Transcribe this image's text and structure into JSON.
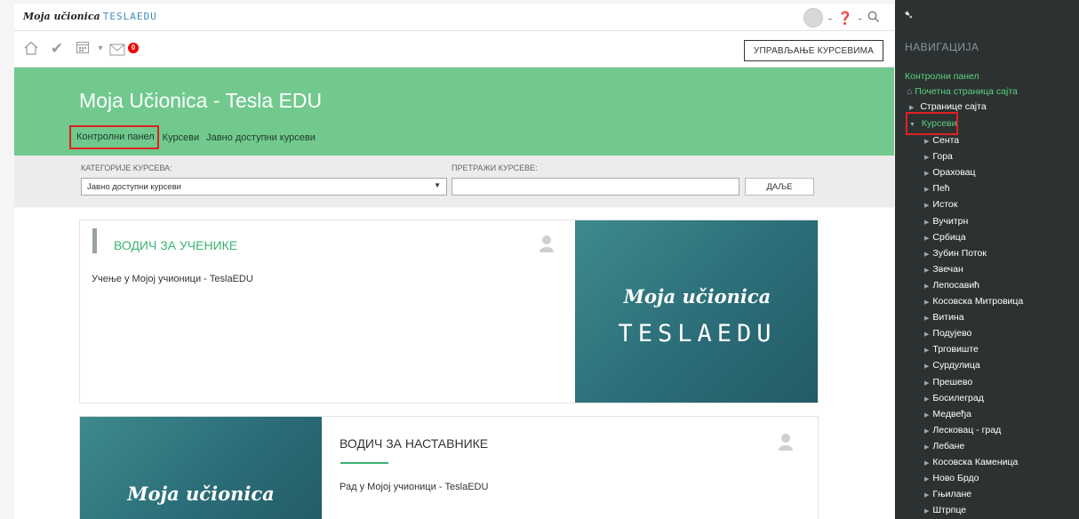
{
  "topbar": {
    "logo_script": "Moja učionica",
    "logo_brand": "TESLAEDU"
  },
  "toolbar": {
    "notification_count": "0",
    "manage_courses_label": "УПРАВЉАЊЕ КУРСЕВИМА"
  },
  "hero": {
    "title": "Moja Učionica - Tesla EDU",
    "breadcrumb": [
      "Контролни панел",
      "Курсеви",
      "Јавно доступни курсеви"
    ]
  },
  "filter": {
    "category_label": "КАТЕГОРИЈЕ КУРСЕВА:",
    "category_value": "Јавно доступни курсеви",
    "search_label": "ПРЕТРАЖИ КУРСЕВЕ:",
    "search_value": "",
    "next_button": "ДАЉЕ"
  },
  "courses": [
    {
      "title": "ВОДИЧ ЗА УЧЕНИКЕ",
      "description": "Учење у Мојој учионици - TeslaEDU",
      "title_color": "#3cb371"
    },
    {
      "title": "ВОДИЧ ЗА НАСТАВНИКЕ",
      "description": "Рад у Мојој учионици - TeslaEDU"
    }
  ],
  "course_image": {
    "script": "Moja učionica",
    "brand": "TESLAEDU"
  },
  "nav": {
    "heading": "НАВИГАЦИЈА",
    "dashboard": "Контролни панел",
    "site_home": "Почетна страница сајта",
    "site_pages": "Странице сајта",
    "courses": "Курсеви",
    "course_list": [
      "Сента",
      "Гора",
      "Ораховац",
      "Пећ",
      "Исток",
      "Вучитрн",
      "Србица",
      "Зубин Поток",
      "Звечан",
      "Лепосавић",
      "Косовска Митровица",
      "Витина",
      "Подујево",
      "Трговиште",
      "Сурдулица",
      "Прешево",
      "Босилеград",
      "Медвеђа",
      "Лесковац - град",
      "Лебане",
      "Косовска Каменица",
      "Ново Брдо",
      "Гњилане",
      "Штрпце"
    ],
    "accent_color": "#5bd17f"
  }
}
